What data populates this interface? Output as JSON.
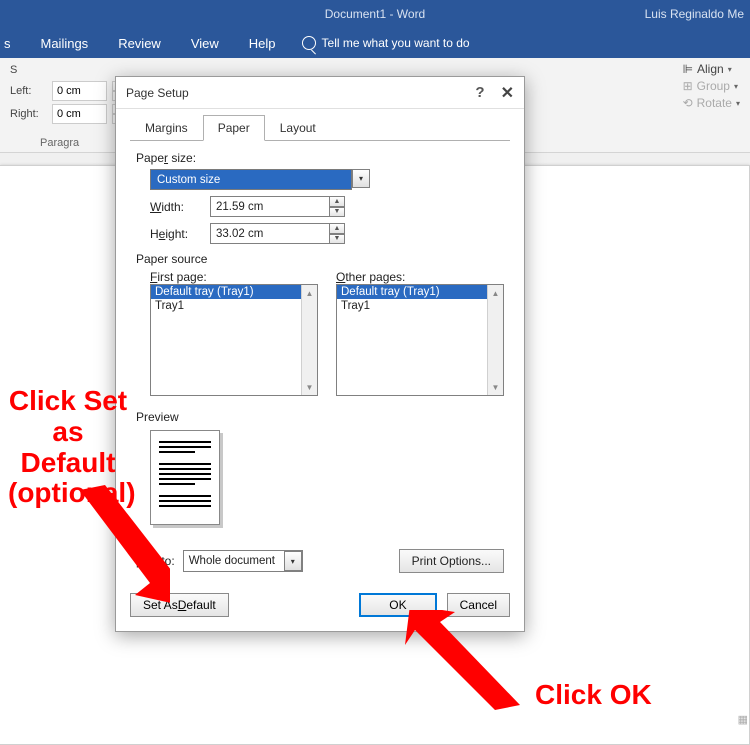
{
  "window": {
    "title": "Document1 - Word",
    "user": "Luis Reginaldo Me"
  },
  "ribbon": {
    "tabs": [
      "s",
      "Mailings",
      "Review",
      "View",
      "Help"
    ],
    "tell_me": "Tell me what you want to do",
    "left": {
      "label_left": "Left:",
      "value_left": "0 cm",
      "label_right": "Right:",
      "value_right": "0 cm",
      "group": "Paragra"
    },
    "right": {
      "align": "Align",
      "group": "Group",
      "rotate": "Rotate"
    }
  },
  "dialog": {
    "title": "Page Setup",
    "tabs": {
      "margins": "Margins",
      "paper": "Paper",
      "layout": "Layout"
    },
    "paper_size_label": "Paper size:",
    "paper_size_value": "Custom size",
    "width_label": "Width:",
    "width_value": "21.59 cm",
    "height_label": "Height:",
    "height_value": "33.02 cm",
    "paper_source_label": "Paper source",
    "first_page_label": "First page:",
    "other_pages_label": "Other pages:",
    "tray_options": [
      "Default tray (Tray1)",
      "Tray1"
    ],
    "preview_label": "Preview",
    "apply_to_label": "pply to:",
    "apply_to_value": "Whole document",
    "print_options": "Print Options...",
    "set_default": "Set As Default",
    "ok": "OK",
    "cancel": "Cancel"
  },
  "annotations": {
    "left": "Click Set as Default (optional)",
    "right": "Click OK"
  }
}
